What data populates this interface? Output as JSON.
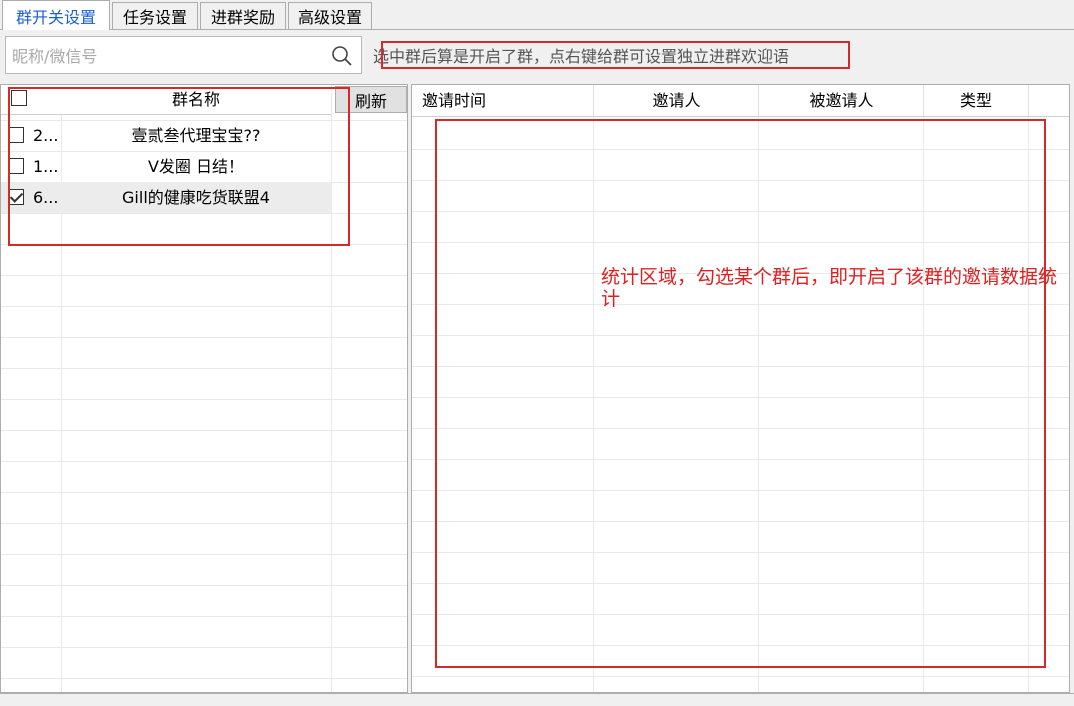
{
  "tabs": [
    {
      "label": "群开关设置",
      "active": true
    },
    {
      "label": "任务设置",
      "active": false
    },
    {
      "label": "进群奖励",
      "active": false
    },
    {
      "label": "高级设置",
      "active": false
    }
  ],
  "search": {
    "placeholder": "昵称/微信号",
    "value": "",
    "icon": "search-icon"
  },
  "hint": "选中群后算是开启了群，点右键给群可设置独立进群欢迎语",
  "group_list": {
    "header_name": "群名称",
    "refresh_label": "刷新",
    "rows": [
      {
        "id": "2...",
        "name": "壹贰叁代理宝宝??",
        "checked": false
      },
      {
        "id": "1...",
        "name": "V发圈 日结！",
        "checked": false
      },
      {
        "id": "6...",
        "name": "Gill的健康吃货联盟4",
        "checked": true
      }
    ]
  },
  "invite_table": {
    "columns": [
      "邀请时间",
      "邀请人",
      "被邀请人",
      "类型"
    ]
  },
  "annotation": "统计区域，勾选某个群后，即开启了该群的邀请数据统计",
  "colors": {
    "accent": "#1a5fd0",
    "annotation": "#d42a2a"
  }
}
